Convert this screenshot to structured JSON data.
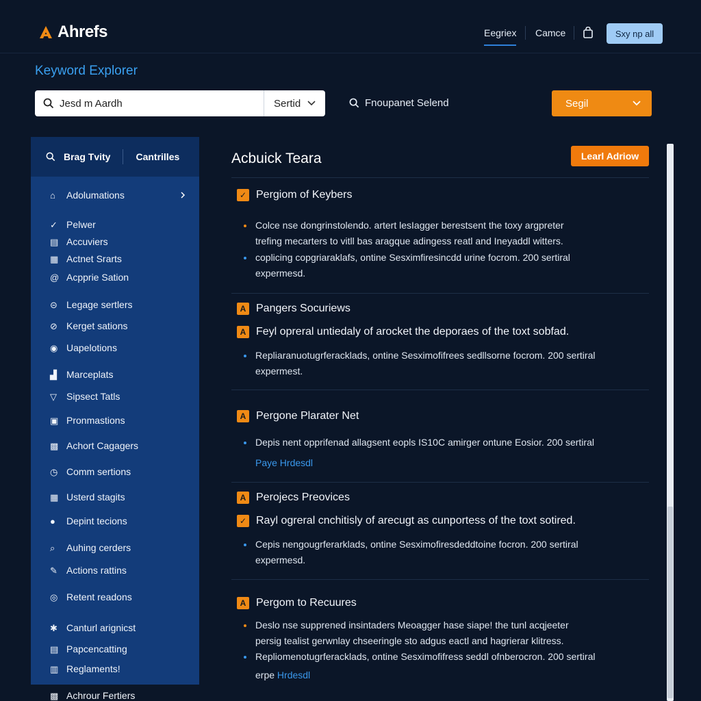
{
  "header": {
    "logo_text": "Ahrefs",
    "nav": [
      "Eegriex",
      "Camce"
    ],
    "signup_label": "Sxy np all",
    "accent": "#f08a15"
  },
  "page_title": "Keyword Explorer",
  "search": {
    "value": "Jesd m Aardh",
    "select_value": "Sertid",
    "frequent_label": "Fnoupanet Selend",
    "go_label": "Segil"
  },
  "sidebar": {
    "tabs": [
      "Brag Tvity",
      "Cantrilles"
    ],
    "items": [
      {
        "label": "Adolumations",
        "icon": "home-icon"
      },
      {
        "label": "Pelwer",
        "icon": "check-icon"
      },
      {
        "label": "Accuviers",
        "icon": "doc-icon"
      },
      {
        "label": "Actnet Srarts",
        "icon": "grid-icon"
      },
      {
        "label": "Acpprie Sation",
        "icon": "at-icon"
      },
      {
        "label": "Legage sertlers",
        "icon": "circle-icon"
      },
      {
        "label": "Kerget sations",
        "icon": "compass-icon"
      },
      {
        "label": "Uapelotions",
        "icon": "target-icon"
      },
      {
        "label": "Marceplats",
        "icon": "bar-chart-icon"
      },
      {
        "label": "Sipsect Tatls",
        "icon": "filter-icon"
      },
      {
        "label": "Pronmastions",
        "icon": "book-icon"
      },
      {
        "label": "Achort Cagagers",
        "icon": "image-icon"
      },
      {
        "label": "Comm sertions",
        "icon": "clock-icon"
      },
      {
        "label": "Usterd stagits",
        "icon": "table-icon"
      },
      {
        "label": "Depint tecions",
        "icon": "comment-icon"
      },
      {
        "label": "Auhing cerders",
        "icon": "search-icon"
      },
      {
        "label": "Actions rattins",
        "icon": "edit-icon"
      },
      {
        "label": "Retent readons",
        "icon": "globe-icon"
      },
      {
        "label": "Canturl arignicst",
        "icon": "settings-icon"
      },
      {
        "label": "Papcencatting",
        "icon": "list-icon"
      },
      {
        "label": "Reglaments!",
        "icon": "file-icon"
      },
      {
        "label": "Achrour Fertiers",
        "icon": "link-icon"
      }
    ]
  },
  "content": {
    "title": "Acbuick Teara",
    "learn_label": "Learl Adriow",
    "sections": [
      {
        "heading": "Pergiom of Keybers",
        "badge": "✓",
        "bullets": [
          {
            "color": "#f08a15",
            "lines": [
              "Colce nse dongrinstolendo. artert lesIagger berestsent the toxy argpreter",
              "trefing mecarters to vitll bas aragque adingess reatl and Ineyaddl witters."
            ]
          },
          {
            "color": "#3a98ec",
            "lines": [
              "coplicing copgriaraklafs, ontine Sesximfiresincdd urine focrom. 200 sertiral",
              "expermesd."
            ]
          }
        ]
      },
      {
        "heading": "Pangers Socuriews",
        "badge": "A",
        "sub": "Feyl opreral untiedaly of arocket the deporaes of the toxt sobfad.",
        "bullets": [
          {
            "color": "#3a98ec",
            "lines": [
              "Repliaranuotugrferacklads, ontine Sesximofifrees sedllsorne focrom. 200 sertiral",
              "expermest."
            ]
          }
        ]
      },
      {
        "heading": "Pergone Plarater Net",
        "badge": "A",
        "bullets": [
          {
            "color": "#3a98ec",
            "lines": [
              "Depis nent opprifenad allagsent eopls IS10C amirger ontune Eosior. 200 sertiral"
            ]
          }
        ],
        "link": "Paye Hrdesdl"
      },
      {
        "heading": "Perojecs Preovices",
        "badge": "A",
        "sub": "Rayl ogreral cnchitisly of arecugt as cunportess of the toxt sotired.",
        "bullets": [
          {
            "color": "#3a98ec",
            "lines": [
              "Cepis nengougrferarklads, ontine Sesximofiresdeddtoine focron. 200 sertiral",
              "expermesd."
            ]
          }
        ]
      },
      {
        "heading": "Pergom to Recuures",
        "badge": "A",
        "bullets": [
          {
            "color": "#f08a15",
            "lines": [
              "Deslo nse supprened insintaders Meoagger hase siape! the tunl acqjeeter",
              "persig tealist gerwnlay chseeringle sto adgus eactl and hagrierar klitress."
            ]
          },
          {
            "color": "#3a98ec",
            "lines": [
              "Repliomenotugrferacklads, ontine Sesximofifress seddl ofnberocron. 200 sertiral"
            ]
          }
        ],
        "link_prefix": "erpe",
        "link": "Hrdesdl"
      }
    ]
  }
}
